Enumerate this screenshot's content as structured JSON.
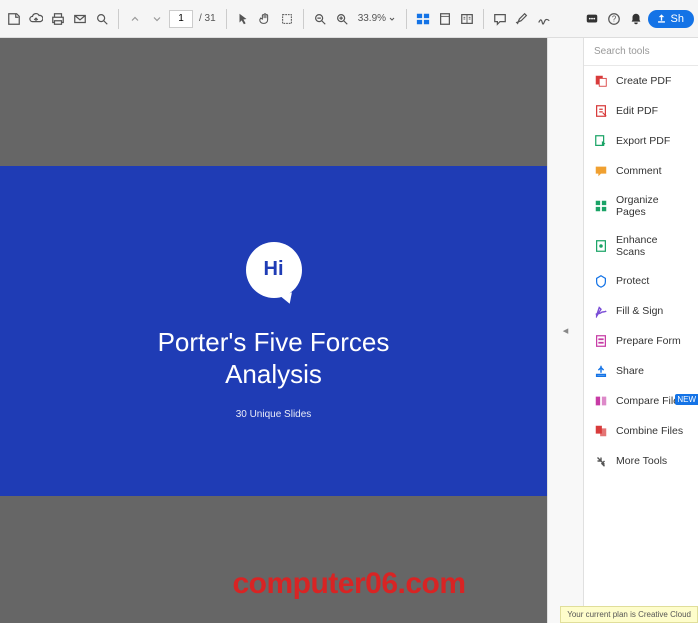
{
  "toolbar": {
    "page_current": "1",
    "page_total": "/ 31",
    "zoom": "33.9%",
    "share_label": "Sh"
  },
  "slide": {
    "bubble": "Hi",
    "title_line1": "Porter's Five Forces",
    "title_line2": "Analysis",
    "subtitle": "30 Unique Slides"
  },
  "tools": {
    "search_placeholder": "Search tools",
    "items": [
      {
        "label": "Create PDF",
        "color": "#d83b3b"
      },
      {
        "label": "Edit PDF",
        "color": "#d83b3b"
      },
      {
        "label": "Export PDF",
        "color": "#1aa366"
      },
      {
        "label": "Comment",
        "color": "#f0a030"
      },
      {
        "label": "Organize Pages",
        "color": "#1aa366"
      },
      {
        "label": "Enhance Scans",
        "color": "#1aa366"
      },
      {
        "label": "Protect",
        "color": "#1473e6"
      },
      {
        "label": "Fill & Sign",
        "color": "#7a4dd6"
      },
      {
        "label": "Prepare Form",
        "color": "#c73ba5"
      },
      {
        "label": "Share",
        "color": "#1473e6"
      },
      {
        "label": "Compare Files",
        "color": "#c73ba5",
        "new": "NEW"
      },
      {
        "label": "Combine Files",
        "color": "#d83b3b"
      },
      {
        "label": "More Tools",
        "color": "#555"
      }
    ]
  },
  "watermark": "computer06.com",
  "status": "Your current plan is Creative Cloud"
}
